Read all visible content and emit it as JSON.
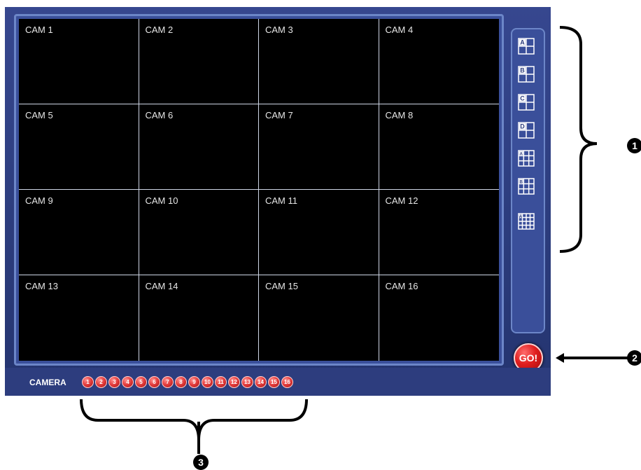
{
  "grid": {
    "cells": [
      {
        "label": "CAM 1"
      },
      {
        "label": "CAM 2"
      },
      {
        "label": "CAM 3"
      },
      {
        "label": "CAM 4"
      },
      {
        "label": "CAM 5"
      },
      {
        "label": "CAM 6"
      },
      {
        "label": "CAM 7"
      },
      {
        "label": "CAM 8"
      },
      {
        "label": "CAM 9"
      },
      {
        "label": "CAM 10"
      },
      {
        "label": "CAM 11"
      },
      {
        "label": "CAM 12"
      },
      {
        "label": "CAM 13"
      },
      {
        "label": "CAM 14"
      },
      {
        "label": "CAM 15"
      },
      {
        "label": "CAM 16"
      }
    ]
  },
  "layout_buttons": [
    {
      "letter": "A",
      "icon": "quad-layout-icon"
    },
    {
      "letter": "B",
      "icon": "quad-layout-icon"
    },
    {
      "letter": "C",
      "icon": "quad-layout-icon"
    },
    {
      "letter": "D",
      "icon": "quad-layout-icon"
    },
    {
      "letter": "A",
      "icon": "nine-layout-icon"
    },
    {
      "letter": "B",
      "icon": "nine-layout-icon"
    },
    {
      "letter": "A",
      "icon": "sixteen-layout-icon"
    }
  ],
  "go_button": {
    "label": "GO!"
  },
  "bottom_bar": {
    "camera_label": "CAMERA",
    "camera_buttons": [
      "1",
      "2",
      "3",
      "4",
      "5",
      "6",
      "7",
      "8",
      "9",
      "10",
      "11",
      "12",
      "13",
      "14",
      "15",
      "16"
    ]
  },
  "annotations": {
    "badge_1": "1",
    "badge_2": "2",
    "badge_3": "3"
  },
  "colors": {
    "panel_blue": "#2d3d7e",
    "frame_border": "#6c86c8",
    "go_red": "#e01e1e"
  }
}
